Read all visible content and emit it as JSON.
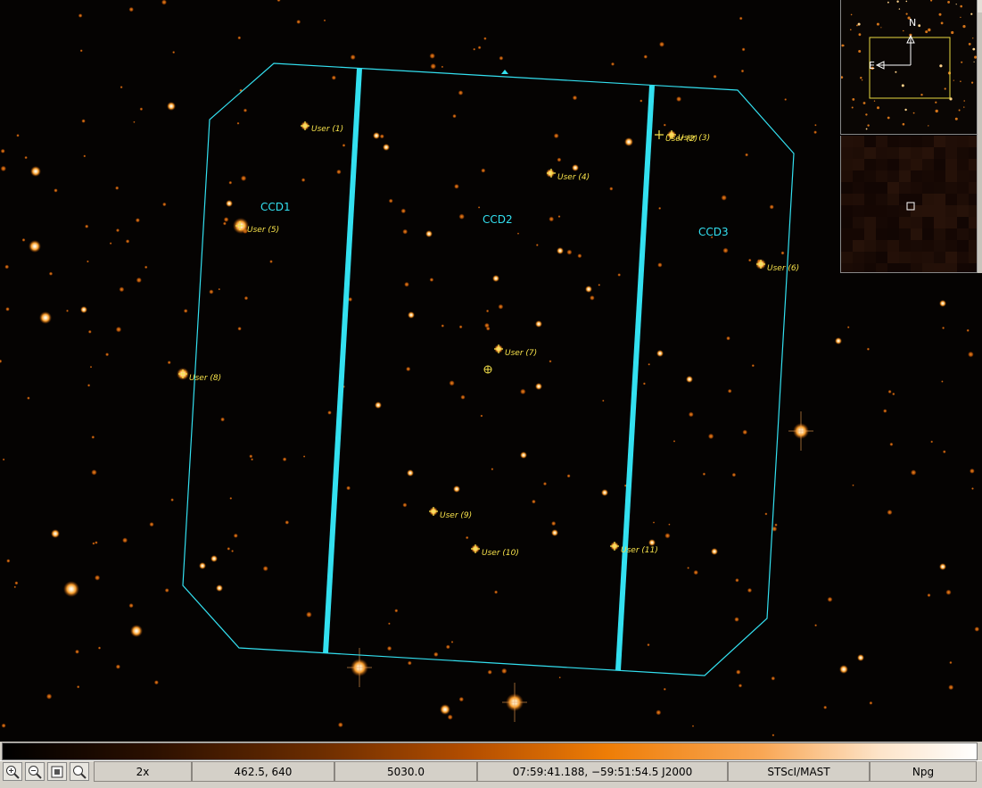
{
  "fov": {
    "ccd_labels": [
      "CCD1",
      "CCD2",
      "CCD3"
    ]
  },
  "targets": [
    "User (1)",
    "User (2)",
    "User (3)",
    "User (4)",
    "User (5)",
    "User (6)",
    "User (7)",
    "User (8)",
    "User (9)",
    "User (10)",
    "User (11)"
  ],
  "compass": {
    "north": "N",
    "east": "E"
  },
  "toolbar": {
    "zoom_in": "zoom-in-icon",
    "zoom_out": "zoom-out-icon",
    "zoom_fit": "zoom-fit-icon",
    "zoom_actual": "zoom-actual-icon"
  },
  "status": {
    "zoom": "2x",
    "pixel_coords": "462.5, 640",
    "pixel_value": "5030.0",
    "world_coords": "07:59:41.188, −59:51:54.5 J2000",
    "source": "STScI/MAST",
    "mode": "Npg"
  },
  "colors": {
    "fov_outline": "#33e0f0",
    "marker": "#f5e04a",
    "background": "#050302"
  }
}
